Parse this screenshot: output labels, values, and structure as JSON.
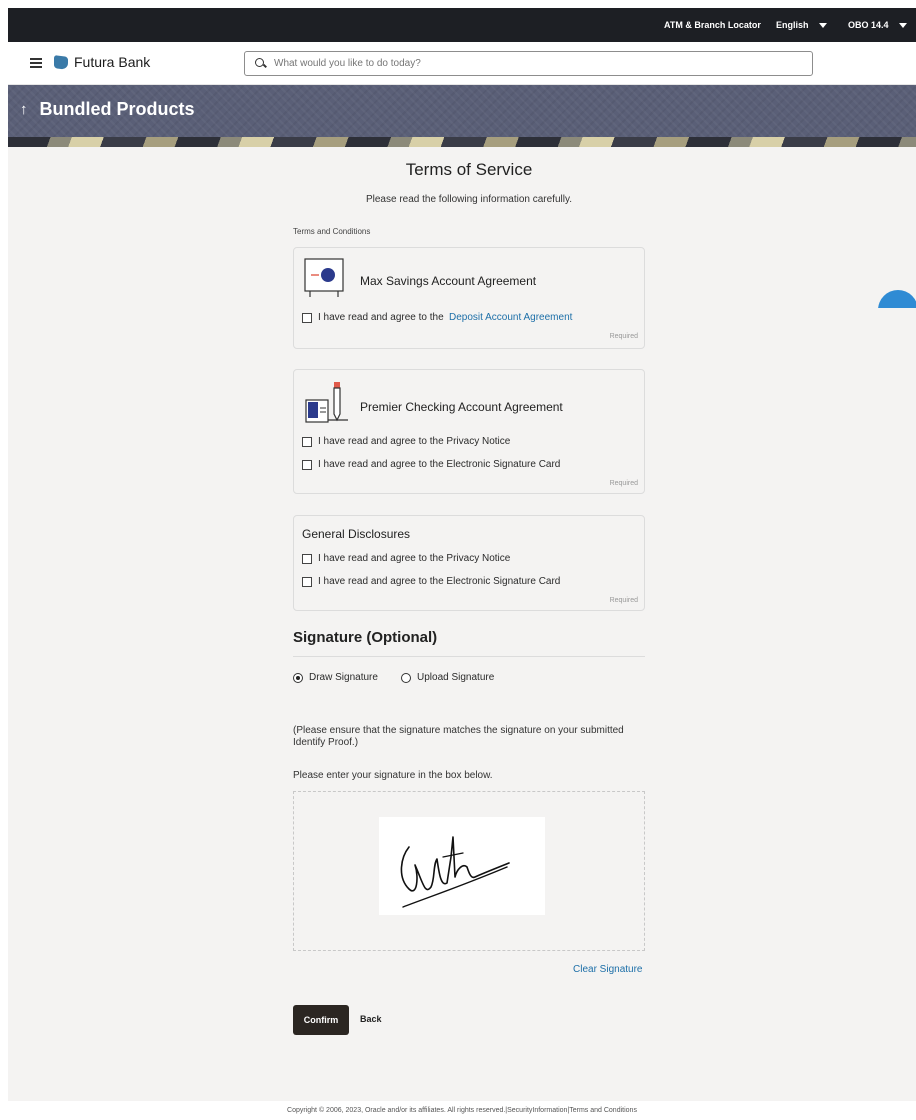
{
  "topbar": {
    "atm_locator": "ATM & Branch Locator",
    "language": "English",
    "user": "OBO 14.4"
  },
  "header": {
    "brand": "Futura Bank",
    "search_placeholder": "What would you like to do today?"
  },
  "banner": {
    "title": "Bundled Products"
  },
  "terms": {
    "heading": "Terms of Service",
    "subheading": "Please read the following information carefully.",
    "section_label": "Terms and Conditions",
    "cards": [
      {
        "title": "Max Savings Account Agreement",
        "checks": [
          {
            "prefix": "I have read and agree to the ",
            "link": "Deposit Account Agreement"
          }
        ],
        "required": "Required"
      },
      {
        "title": "Premier Checking Account Agreement",
        "checks": [
          {
            "text": "I have read and agree to the Privacy Notice"
          },
          {
            "text": "I have read and agree to the Electronic Signature Card"
          }
        ],
        "required": "Required"
      },
      {
        "title": "General Disclosures",
        "checks": [
          {
            "text": "I have read and agree to the Privacy Notice"
          },
          {
            "text": "I have read and agree to the Electronic Signature Card"
          }
        ],
        "required": "Required"
      }
    ]
  },
  "signature": {
    "heading": "Signature (Optional)",
    "options": [
      "Draw Signature",
      "Upload Signature"
    ],
    "selected": "Draw Signature",
    "note": "(Please ensure that the signature matches the signature on your submitted Identify Proof.)",
    "instruction": "Please enter your signature in the box below.",
    "clear_label": "Clear Signature"
  },
  "actions": {
    "confirm": "Confirm",
    "back": "Back"
  },
  "footer": {
    "text": "Copyright © 2006, 2023, Oracle and/or its affiliates. All rights reserved.|SecurityInformation|Terms and Conditions"
  }
}
